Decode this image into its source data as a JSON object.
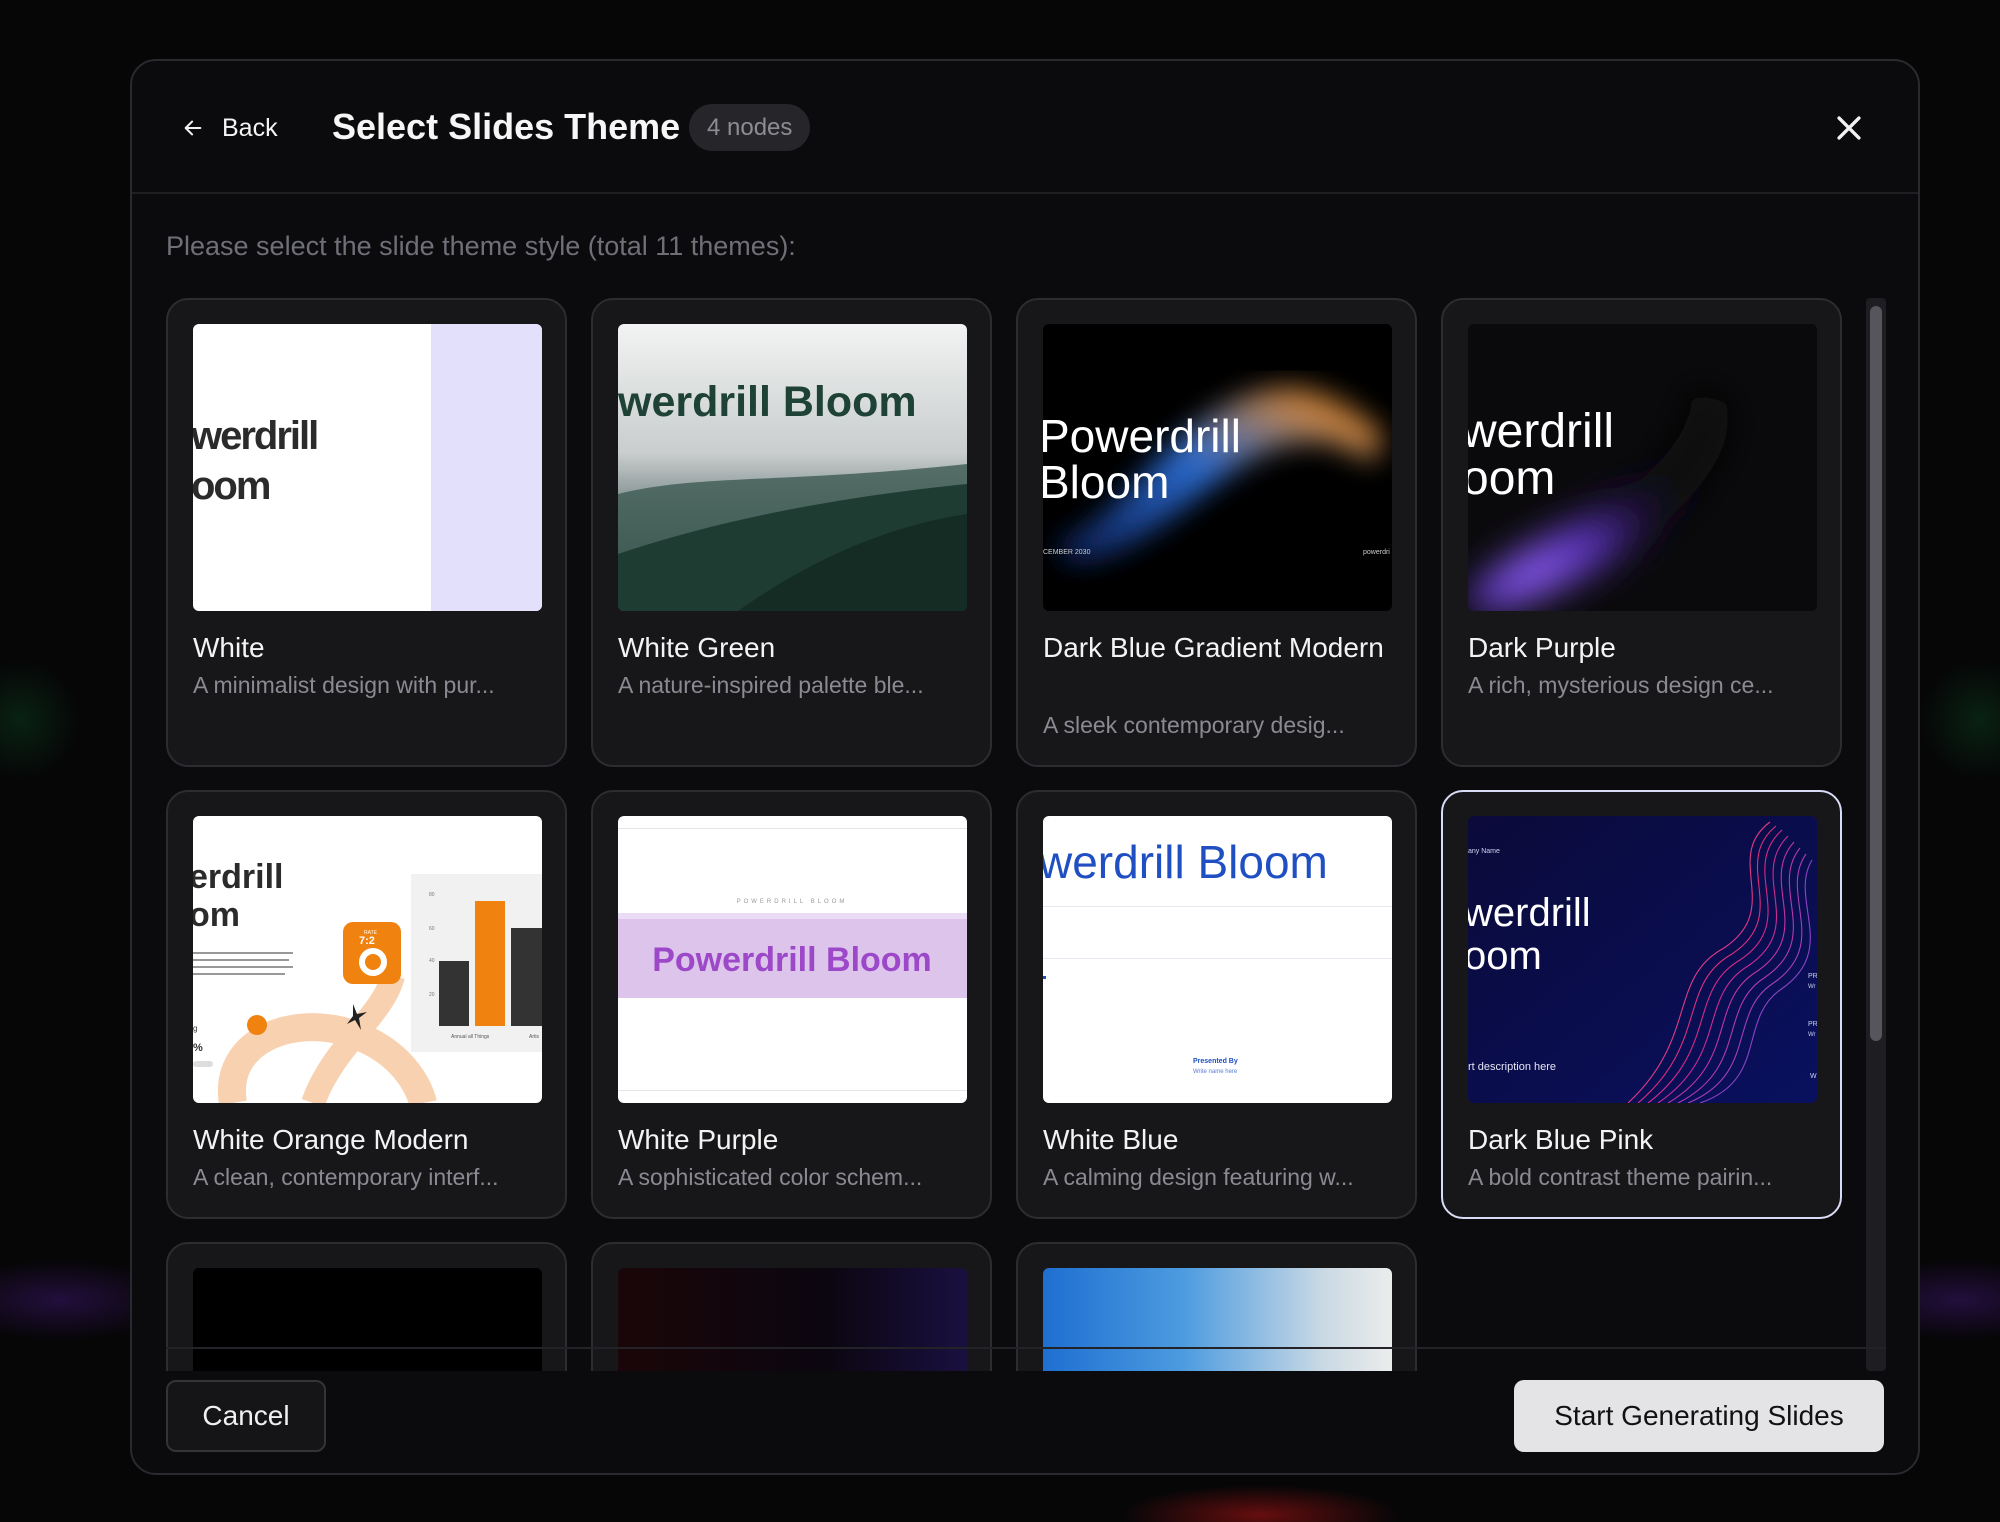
{
  "header": {
    "back_label": "Back",
    "title": "Select Slides Theme",
    "badge": "4 nodes"
  },
  "subtitle": "Please select the slide theme style (total 11 themes):",
  "themes": [
    {
      "name": "White",
      "desc": "A minimalist design with pur...",
      "selected": false
    },
    {
      "name": "White Green",
      "desc": "A nature-inspired palette ble...",
      "selected": false
    },
    {
      "name": "Dark Blue Gradient Modern",
      "desc": "A sleek contemporary desig...",
      "selected": false
    },
    {
      "name": "Dark Purple",
      "desc": "A rich, mysterious design ce...",
      "selected": false
    },
    {
      "name": "White Orange Modern",
      "desc": "A clean, contemporary interf...",
      "selected": false
    },
    {
      "name": "White Purple",
      "desc": "A sophisticated color schem...",
      "selected": false
    },
    {
      "name": "White Blue",
      "desc": "A calming design featuring w...",
      "selected": false
    },
    {
      "name": "Dark Blue Pink",
      "desc": "A bold contrast theme pairin...",
      "selected": true
    }
  ],
  "previews": {
    "white": [
      "werdrill",
      "oom"
    ],
    "white_green": "werdrill Bloom",
    "dark_blue_gradient": [
      "Powerdrill",
      "Bloom",
      "CEMBER 2030",
      "powerdri"
    ],
    "dark_purple": [
      "werdrill",
      "oom"
    ],
    "white_orange": [
      "erdrill",
      "om",
      "7:2",
      "RATE",
      "Annual all Things",
      "Artis",
      "g",
      "%",
      "80",
      "60",
      "40",
      "20"
    ],
    "white_purple": [
      "POWERDRILL BLOOM",
      "Powerdrill Bloom"
    ],
    "white_blue": [
      "werdrill Bloom",
      "Presented By",
      "Write name here"
    ],
    "dark_blue_pink": [
      "werdrill",
      "oom",
      "any Name",
      "rt description here",
      "PR",
      "Wr",
      "PR",
      "Wr",
      "W"
    ]
  },
  "footer": {
    "cancel_label": "Cancel",
    "start_label": "Start Generating Slides"
  },
  "colors": {
    "accent_selected": "#d8dcf5",
    "primary_button": "#e4e4e6",
    "modal_bg": "#0b0b0d"
  },
  "icons": {
    "back": "arrow-left-icon",
    "close": "close-icon"
  }
}
